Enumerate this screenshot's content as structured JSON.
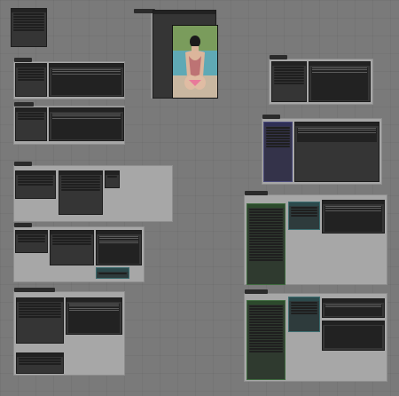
{
  "canvas": {
    "background": "#7a7a7a",
    "group_color": "#a7a7a7"
  },
  "groups": {
    "g1": {
      "title": ""
    },
    "g2": {
      "title": ""
    },
    "g3": {
      "title": ""
    },
    "g4": {
      "title": ""
    },
    "g5": {
      "title": ""
    },
    "g6": {
      "title": ""
    },
    "g7": {
      "title": ""
    },
    "g8": {
      "title": ""
    },
    "g9": {
      "title": ""
    },
    "g10": {
      "title": ""
    },
    "g11": {
      "title": ""
    }
  },
  "nodes": {
    "image_preview_title": "",
    "settings_panel_title": "",
    "text_node_title": "",
    "loader_title": ""
  },
  "icons": {
    "node_dot": "status-dot-icon",
    "output_image": "image-preview-icon"
  },
  "colors": {
    "node_bg": "#353535",
    "node_green": "#2f3a2f",
    "node_teal": "#2e3b3c",
    "node_purple": "#34334a"
  }
}
